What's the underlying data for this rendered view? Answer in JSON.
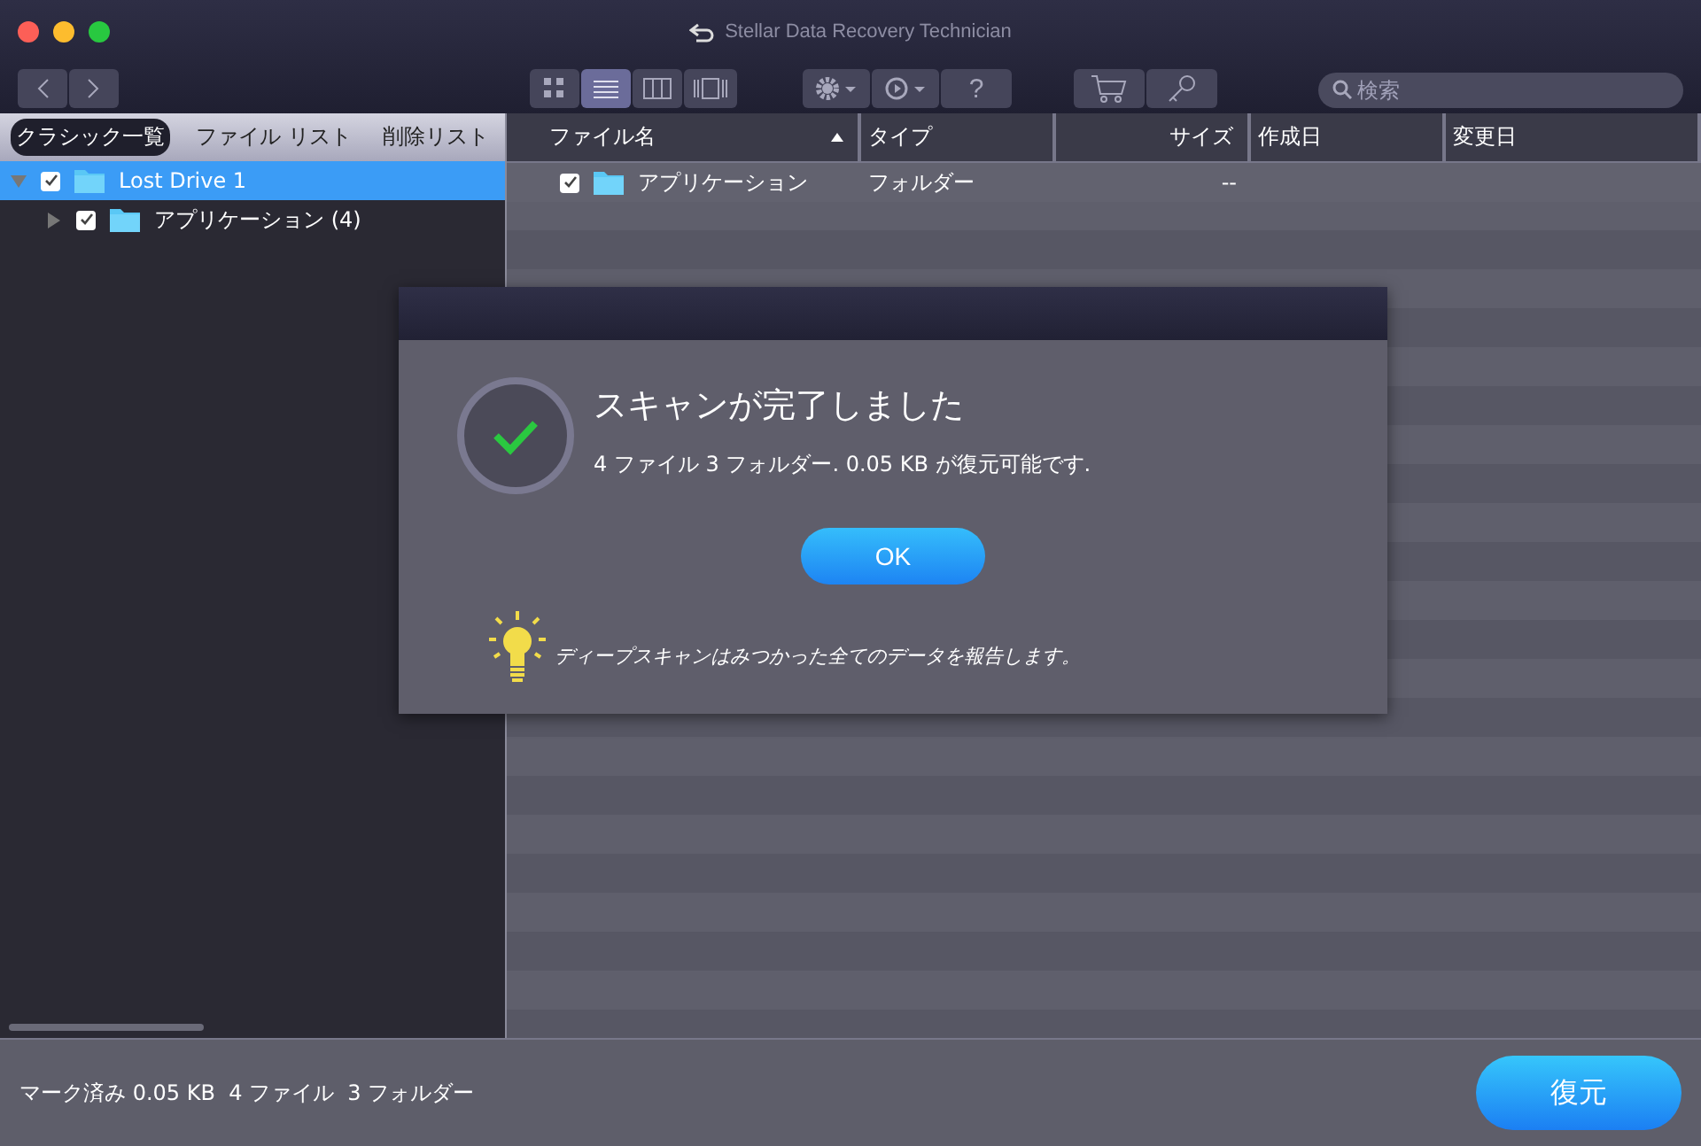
{
  "window": {
    "title": "Stellar Data Recovery Technician"
  },
  "toolbar": {
    "views": [
      {
        "kind": "grid",
        "selected": false
      },
      {
        "kind": "list",
        "selected": true
      },
      {
        "kind": "columns",
        "selected": false
      },
      {
        "kind": "coverflow",
        "selected": false
      }
    ],
    "help": "?",
    "search": {
      "placeholder": "検索"
    }
  },
  "tabs": [
    {
      "label": "クラシック一覧",
      "selected": true
    },
    {
      "label": "ファイル リスト",
      "selected": false
    },
    {
      "label": "削除リスト",
      "selected": false
    }
  ],
  "tree": [
    {
      "label": "Lost Drive 1",
      "checked": true,
      "expanded": true,
      "selected": true,
      "children": [
        {
          "label": "アプリケーション (4)",
          "checked": true,
          "expanded": false,
          "selected": false
        }
      ]
    }
  ],
  "table": {
    "columns": [
      {
        "label": "ファイル名",
        "sorted": true
      },
      {
        "label": "タイプ",
        "sorted": false
      },
      {
        "label": "サイズ",
        "sorted": false
      },
      {
        "label": "作成日",
        "sorted": false
      },
      {
        "label": "変更日",
        "sorted": false
      }
    ],
    "rows": [
      {
        "checked": true,
        "name": "アプリケーション",
        "type": "フォルダー",
        "size": "--"
      }
    ]
  },
  "dialog": {
    "title": "スキャンが完了しました",
    "message": "4 ファイル 3 フォルダー. 0.05 KB が復元可能です.",
    "button": "OK",
    "tip": "ディープスキャンはみつかった全てのデータを報告します。"
  },
  "status_bar": {
    "summary": "マーク済み 0.05 KB  4 ファイル  3 フォルダー",
    "recover": "復元"
  }
}
